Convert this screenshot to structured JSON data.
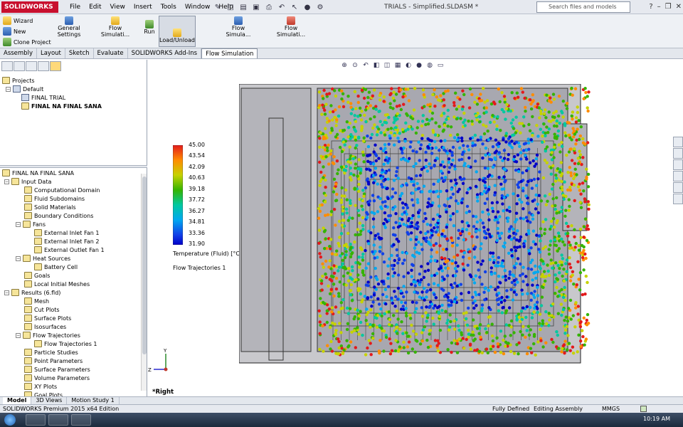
{
  "app": {
    "logo": "SOLIDWORKS",
    "doc_title": "TRIALS - Simplified.SLDASM *"
  },
  "menu": [
    "File",
    "Edit",
    "View",
    "Insert",
    "Tools",
    "Window",
    "Help"
  ],
  "search": {
    "placeholder": "Search files and models"
  },
  "ribbon": {
    "wizard": "Wizard",
    "new": "New",
    "clone": "Clone Project",
    "general_settings": "General Settings",
    "flow_simulation_1": "Flow Simulati...",
    "run": "Run",
    "load_unload": "Load/Unload",
    "flow_simulation_2": "Flow Simula...",
    "flow_simulation_3": "Flow Simulati..."
  },
  "tabs": [
    "Assembly",
    "Layout",
    "Sketch",
    "Evaluate",
    "SOLIDWORKS Add-Ins",
    "Flow Simulation"
  ],
  "active_tab": "Flow Simulation",
  "projects_tree": {
    "root": "Projects",
    "default": "Default",
    "final_trial": "FINAL TRIAL",
    "final_na_final_sana": "FINAL NA FINAL SANA"
  },
  "analysis_tree": {
    "root": "FINAL NA FINAL SANA",
    "input_data": "Input Data",
    "computational_domain": "Computational Domain",
    "fluid_subdomains": "Fluid Subdomains",
    "solid_materials": "Solid Materials",
    "boundary_conditions": "Boundary Conditions",
    "fans": "Fans",
    "fan1": "External Inlet Fan 1",
    "fan2": "External Inlet Fan 2",
    "fan3": "External Outlet Fan 1",
    "heat_sources": "Heat Sources",
    "battery_cell": "Battery Cell",
    "goals": "Goals",
    "local_meshes": "Local Initial Meshes",
    "results": "Results (6.fld)",
    "mesh": "Mesh",
    "cut_plots": "Cut Plots",
    "surface_plots": "Surface Plots",
    "isosurfaces": "Isosurfaces",
    "flow_trajectories": "Flow Trajectories",
    "flow_trajectories_1": "Flow Trajectories 1",
    "particle_studies": "Particle Studies",
    "point_parameters": "Point Parameters",
    "surface_parameters": "Surface Parameters",
    "volume_parameters": "Volume Parameters",
    "xy_plots": "XY Plots",
    "goal_plots": "Goal Plots"
  },
  "legend": {
    "values": [
      "45.00",
      "43.54",
      "42.09",
      "40.63",
      "39.18",
      "37.72",
      "36.27",
      "34.81",
      "33.36",
      "31.90"
    ],
    "title": "Temperature (Fluid) [°C]",
    "plot_label": "Flow Trajectories 1"
  },
  "view": {
    "name": "*Right"
  },
  "bottom_tabs": [
    "Model",
    "3D Views",
    "Motion Study 1"
  ],
  "status": {
    "edition": "SOLIDWORKS Premium 2015 x64 Edition",
    "defined": "Fully Defined",
    "mode": "Editing Assembly",
    "units": "MMGS"
  },
  "taskbar": {
    "time": "10:19 AM"
  },
  "colors": {
    "ribbon_bg": "#eef1f5",
    "accent": "#c8102e",
    "panel_border": "#9aa3b2"
  }
}
